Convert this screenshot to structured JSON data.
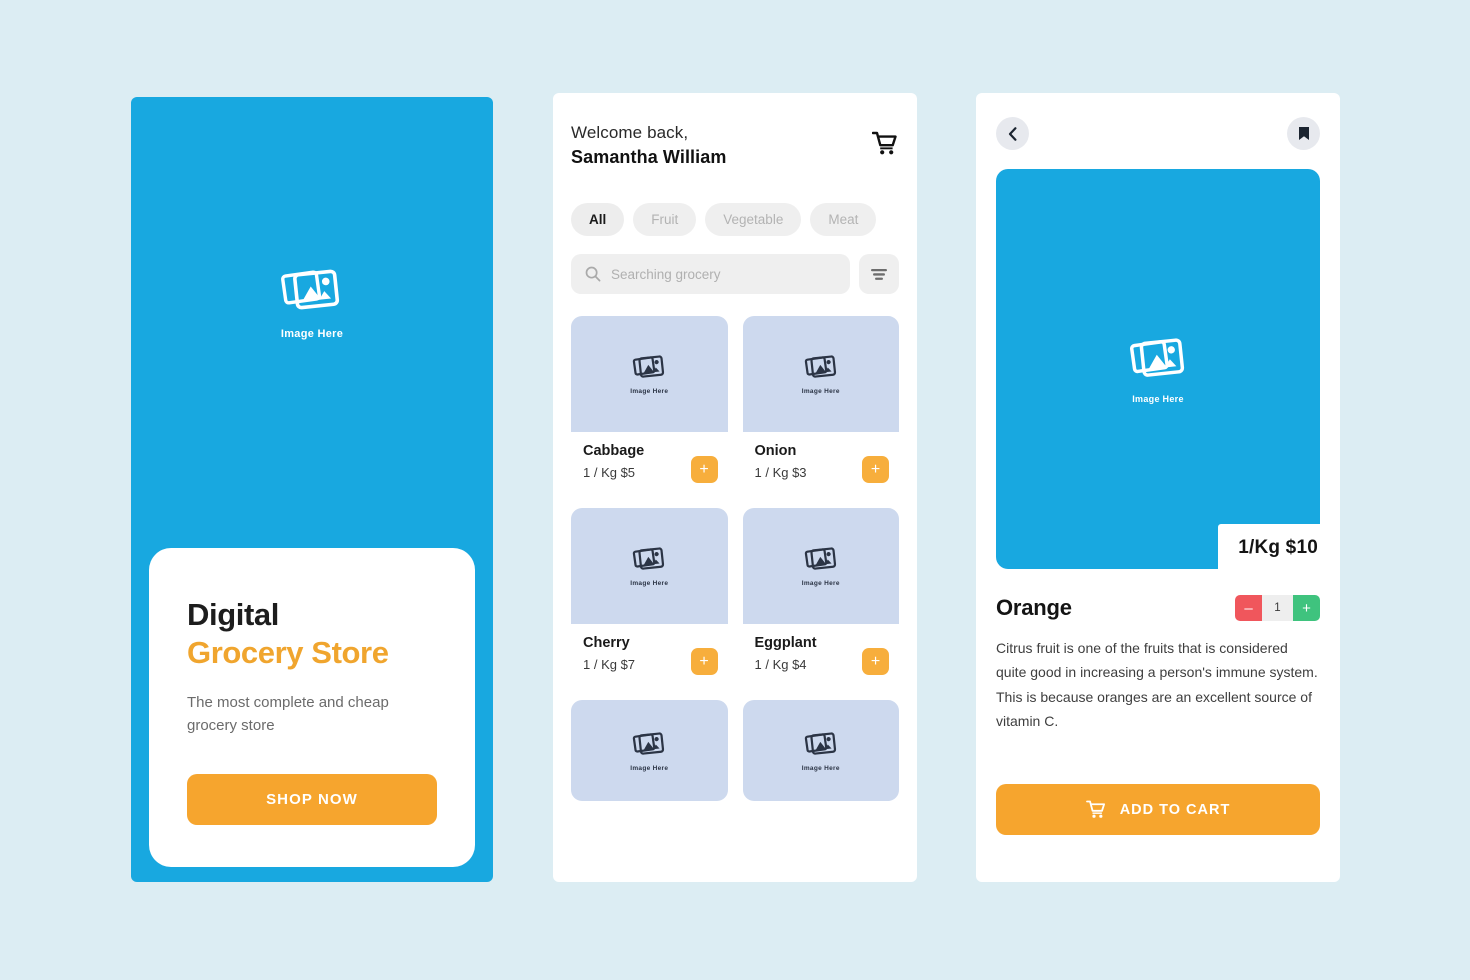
{
  "colors": {
    "page_background": "#dcedf3",
    "brand_blue": "#18a8e0",
    "accent_orange": "#f6a52e",
    "card_image_background": "#cdd9ee",
    "chip_background": "#efefef",
    "stepper_minus": "#f0565c",
    "stepper_plus": "#3fc37e"
  },
  "placeholder": {
    "label": "Image Here",
    "icon": "image-placeholder-icon"
  },
  "splash": {
    "logo_label": "Image Here",
    "title_line1": "Digital",
    "title_line2": "Grocery Store",
    "subtitle": "The most complete and cheap grocery store",
    "cta_label": "SHOP NOW"
  },
  "home": {
    "greeting": "Welcome back,",
    "user_name": "Samantha William",
    "cart_icon": "shopping-cart-icon",
    "categories": [
      {
        "label": "All",
        "active": true
      },
      {
        "label": "Fruit",
        "active": false
      },
      {
        "label": "Vegetable",
        "active": false
      },
      {
        "label": "Meat",
        "active": false
      }
    ],
    "search": {
      "placeholder": "Searching grocery",
      "value": "",
      "icon": "search-icon"
    },
    "filter_icon": "filter-icon",
    "add_label": "+",
    "products": [
      {
        "name": "Cabbage",
        "price": "1 / Kg $5",
        "image_label": "Image Here"
      },
      {
        "name": "Onion",
        "price": "1 / Kg $3",
        "image_label": "Image Here"
      },
      {
        "name": "Cherry",
        "price": "1 / Kg $7",
        "image_label": "Image Here"
      },
      {
        "name": "Eggplant",
        "price": "1 / Kg $4",
        "image_label": "Image Here"
      }
    ],
    "products_partial": [
      {
        "image_label": "Image Here"
      },
      {
        "image_label": "Image Here"
      }
    ]
  },
  "detail": {
    "back_icon": "chevron-left-icon",
    "bookmark_icon": "bookmark-icon",
    "hero_label": "Image Here",
    "price_badge": "1/Kg $10",
    "product_name": "Orange",
    "quantity": "1",
    "decrement_label": "–",
    "increment_label": "+",
    "description": "Citrus fruit is one of the fruits that is considered quite good in increasing a person's immune system. This is because oranges are an excellent source of vitamin C.",
    "cta_label": "ADD TO CART",
    "cta_icon": "shopping-cart-icon"
  }
}
